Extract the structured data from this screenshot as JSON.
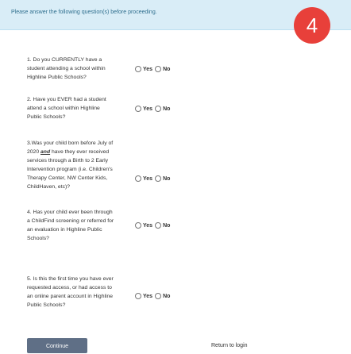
{
  "banner": {
    "text": "Please answer the following question(s) before proceeding."
  },
  "step_badge": "4",
  "questions": [
    {
      "text": "1. Do you CURRENTLY have a student attending a school within Highline Public Schools?",
      "yes": "Yes",
      "no": "No"
    },
    {
      "text": "2. Have you EVER had a student attend a school within Highline Public Schools?",
      "yes": "Yes",
      "no": "No"
    },
    {
      "pre": "3.Was your child born before July of 2020 ",
      "emph": "and",
      "post": " have they ever received services through a Birth to 2 Early Intervention program (i.e. Children's Therapy Center, NW Center Kids, ChildHaven, etc)?",
      "yes": "Yes",
      "no": "No"
    },
    {
      "text": "4. Has your child ever been through a ChildFind screening or referred for an evaluation in Highline Public Schools?",
      "yes": "Yes",
      "no": "No"
    },
    {
      "text": "5. Is this the first time you have ever requested access, or had access to an online parent account in Highline Public Schools?",
      "yes": "Yes",
      "no": "No"
    }
  ],
  "actions": {
    "continue": "Continue",
    "return": "Return to login"
  }
}
